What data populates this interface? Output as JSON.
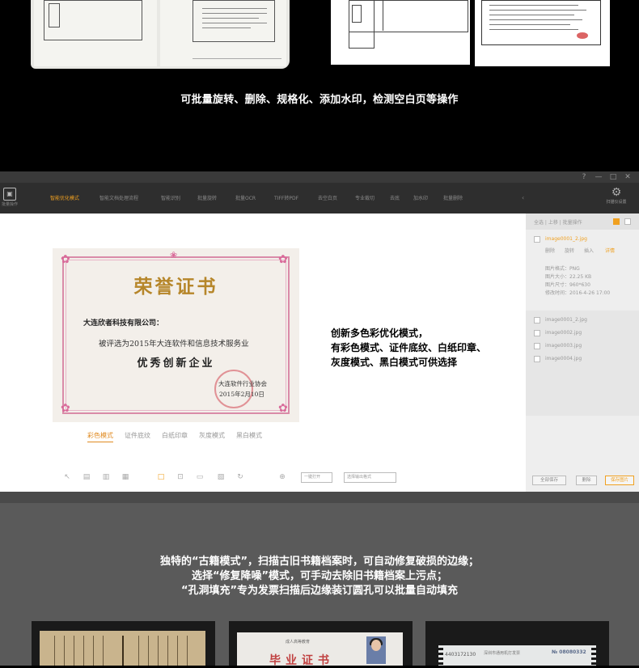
{
  "top_section": {
    "caption": "可批量旋转、删除、规格化、添加水印，检测空白页等操作"
  },
  "app": {
    "window_controls": [
      "?",
      "—",
      "□",
      "✕"
    ],
    "app_name": "批量操作",
    "tabs": [
      {
        "label": "智能优化模式",
        "active": true
      },
      {
        "label": "智能文档处理流程",
        "active": false
      },
      {
        "label": "智能识别",
        "active": false
      },
      {
        "label": "批量旋转",
        "active": false
      },
      {
        "label": "批量OCR",
        "active": false
      },
      {
        "label": "TIFF转PDF",
        "active": false
      },
      {
        "label": "去空白页",
        "active": false
      },
      {
        "label": "专业裁切",
        "active": false
      },
      {
        "label": "去底",
        "active": false
      },
      {
        "label": "加水印",
        "active": false
      },
      {
        "label": "批量删除",
        "active": false
      }
    ],
    "more_symbol": "‹",
    "settings_label": "扫描仪设置",
    "certificate": {
      "title": "荣誉证书",
      "recipient": "大连欣者科技有限公司：",
      "body": "被评选为2015年大连软件和信息技术服务业",
      "award": "优秀创新企业",
      "issuer": "大连软件行业协会",
      "date": "2015年2月10日"
    },
    "modes": [
      {
        "label": "彩色模式",
        "active": true
      },
      {
        "label": "证件底纹",
        "active": false
      },
      {
        "label": "白纸印章",
        "active": false
      },
      {
        "label": "灰度模式",
        "active": false
      },
      {
        "label": "黑白模式",
        "active": false
      }
    ],
    "bottom_selects": [
      "一键打开",
      "选择输出格式"
    ],
    "feature_text": [
      "创新多色彩优化模式，",
      "有彩色模式、证件底纹、白纸印章、",
      "灰度模式、黑白模式可供选择"
    ],
    "panel": {
      "header": "全选 | 上移 | 批量操作",
      "current_file": "image0001_2.jpg",
      "file_actions": [
        "删除",
        "旋转",
        "插入",
        "详情"
      ],
      "info_lines": [
        "图片格式：PNG",
        "图片大小：22.25 KB",
        "图片尺寸：960*630",
        "修改时间：2016-4-26 17:00"
      ],
      "files": [
        "image0001_2.jpg",
        "image0002.jpg",
        "image0003.jpg",
        "image0004.jpg"
      ],
      "buttons": [
        "全部保存",
        "删除",
        "保存图片"
      ]
    }
  },
  "lower_section": {
    "caption_lines": [
      "独特的“古籍模式”，扫描古旧书籍档案时，可自动修复破损的边缘；",
      "选择“修复降噪”模式，可手动去除旧书籍档案上污点；",
      "“孔洞填充”专为发票扫描后边缘装订圆孔可以批量自动填充"
    ],
    "diploma_title": "毕业证书",
    "diploma_header": "成人高等教育",
    "invoice_code": "4403172130",
    "invoice_title": "深圳市通用机打发票",
    "invoice_number": "№ 08080332"
  }
}
